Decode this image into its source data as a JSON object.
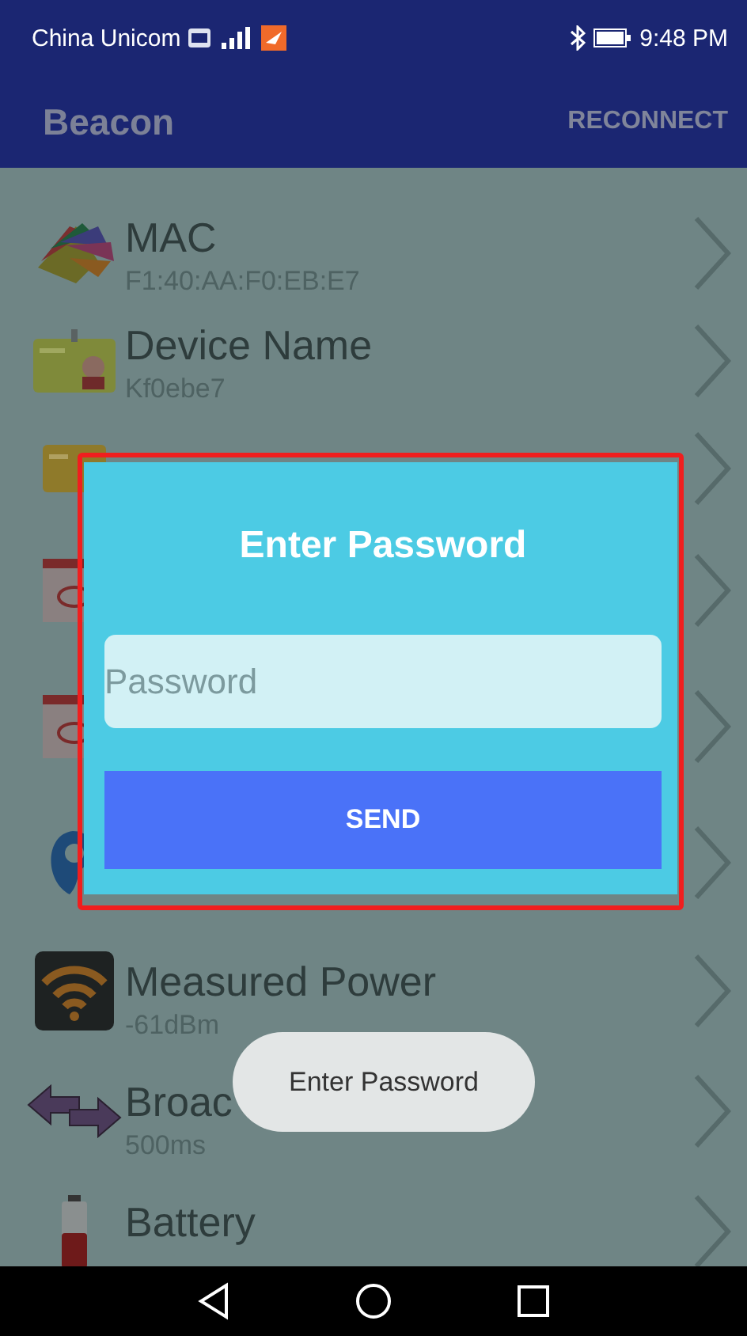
{
  "status_bar": {
    "carrier": "China Unicom",
    "time": "9:48 PM"
  },
  "app_bar": {
    "title": "Beacon",
    "action": "RECONNECT"
  },
  "list": [
    {
      "title": "MAC",
      "value": "F1:40:AA:F0:EB:E7"
    },
    {
      "title": "Device Name",
      "value": "Kf0ebe7"
    },
    {
      "title": "Measured Power",
      "value": "-61dBm"
    },
    {
      "title": "Broac",
      "value": "500ms"
    },
    {
      "title": "Battery"
    }
  ],
  "dialog": {
    "title": "Enter Password",
    "password": {
      "placeholder": "Password"
    },
    "button": "SEND"
  },
  "toast": "Enter Password"
}
